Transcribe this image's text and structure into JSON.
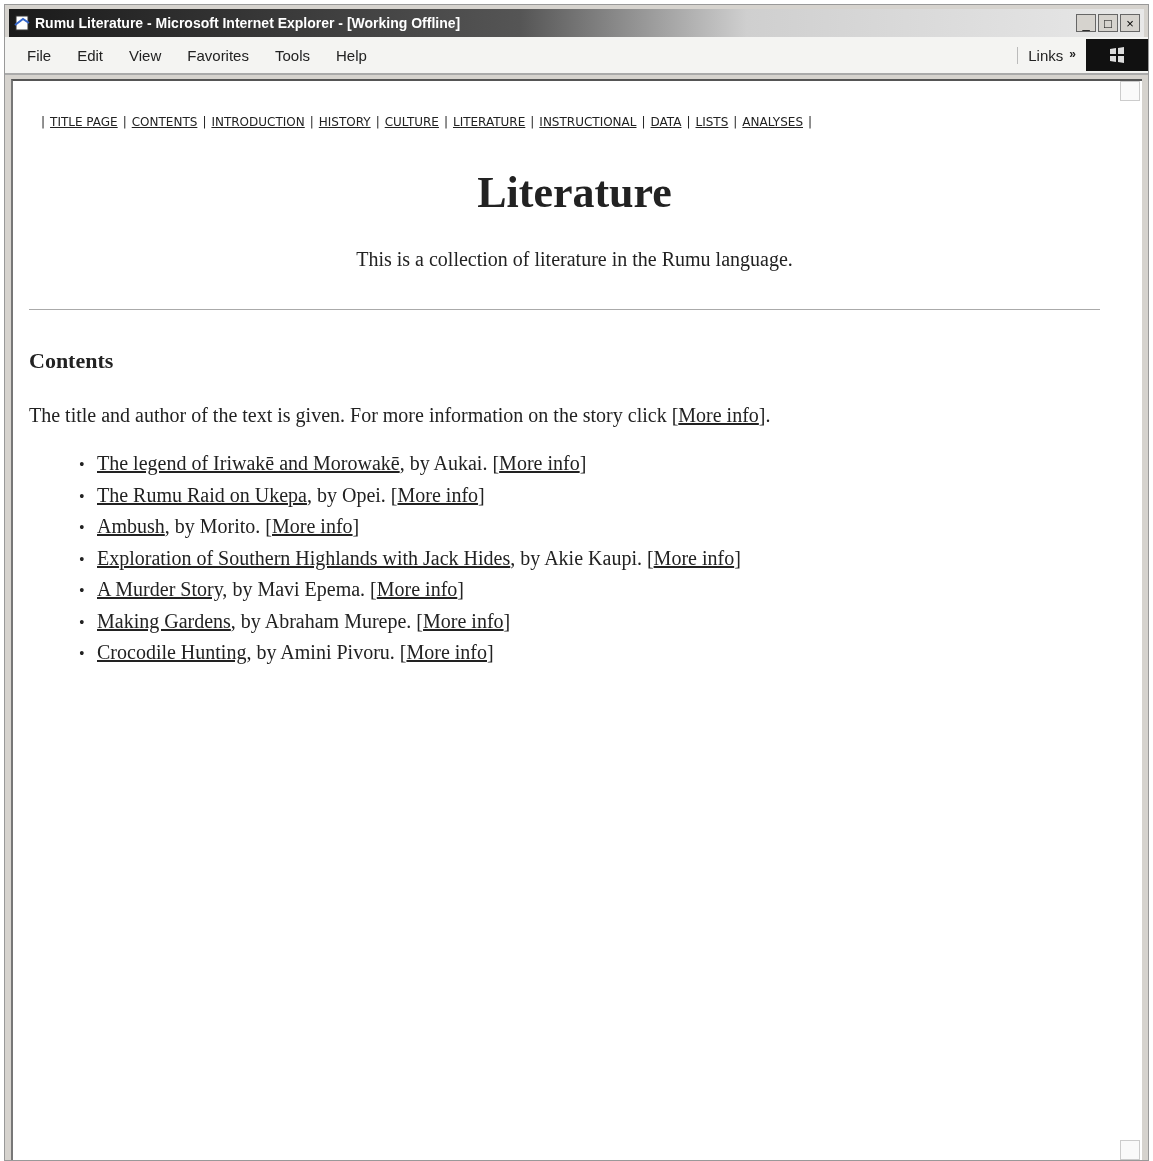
{
  "window": {
    "title": "Rumu Literature - Microsoft Internet Explorer - [Working Offline]",
    "controls": [
      "_",
      "□",
      "×"
    ]
  },
  "menu": [
    "File",
    "Edit",
    "View",
    "Favorites",
    "Tools",
    "Help"
  ],
  "links_bar": {
    "label": "Links",
    "chevron": "»"
  },
  "nav": {
    "separator": "|",
    "items": [
      "TITLE PAGE",
      "CONTENTS",
      "INTRODUCTION",
      "HISTORY",
      "CULTURE",
      "LITERATURE",
      "INSTRUCTIONAL",
      "DATA",
      "LISTS",
      "ANALYSES"
    ]
  },
  "heading": "Literature",
  "subtitle": "This is a collection of literature in the Rumu language.",
  "section_heading": "Contents",
  "intro": {
    "before": "The title and author of the text is given. For more information on the story click [",
    "link": "More info",
    "after": "]."
  },
  "bullet": "•",
  "stories": [
    {
      "title": "The legend of Iriwakē and Morowakē",
      "byline": ", by Aukai. [",
      "more": "More info",
      "after": "]"
    },
    {
      "title": "The Rumu Raid on Ukepa",
      "byline": ", by Opei. [",
      "more": "More info",
      "after": "]"
    },
    {
      "title": "Ambush",
      "byline": ", by Morito. [",
      "more": "More info",
      "after": "]"
    },
    {
      "title": "Exploration of Southern Highlands with Jack Hides",
      "byline": ", by Akie Kaupi. [",
      "more": "More info",
      "after": "]"
    },
    {
      "title": "A Murder Story,",
      "byline": " by Mavi Epema. [",
      "more": "More info",
      "after": "]"
    },
    {
      "title": "Making Gardens",
      "byline": ", by Abraham Murepe. [",
      "more": "More info",
      "after": "]"
    },
    {
      "title": "Crocodile Hunting",
      "byline": ", by Amini Pivoru. [",
      "more": "More info",
      "after": "]"
    }
  ]
}
